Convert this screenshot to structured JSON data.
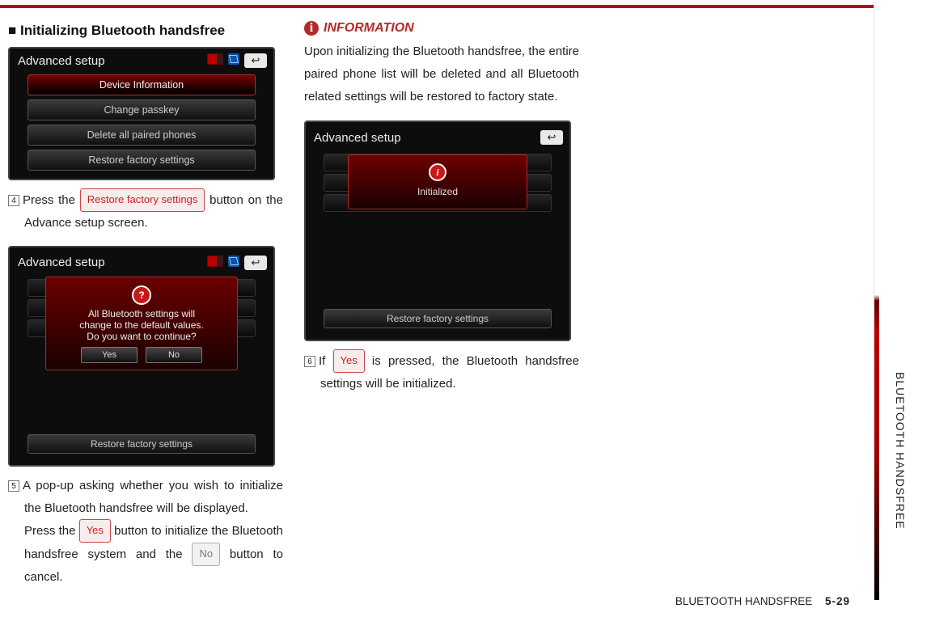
{
  "heading": "■ Initializing Bluetooth handsfree",
  "panel_title": "Advanced setup",
  "back_glyph": "↩",
  "menu": {
    "device_info": "Device Information",
    "change_passkey": "Change passkey",
    "delete_paired": "Delete all paired phones",
    "restore": "Restore factory settings"
  },
  "step4_num": "4",
  "step4_a": "Press the ",
  "step4_chip": "Restore factory settings",
  "step4_b": " button on the Advance setup screen.",
  "popup_q": "?",
  "popup_line1": "All Bluetooth settings will",
  "popup_line2": "change to the default values.",
  "popup_line3": "Do you want to continue?",
  "popup_yes": "Yes",
  "popup_no": "No",
  "popup_bottom": "Restore factory settings",
  "step5_num": "5",
  "step5_a": "A pop-up asking whether you wish to initialize the Bluetooth handsfree will be displayed.",
  "step5_b1": "Press the ",
  "step5_yes": "Yes",
  "step5_b2": "  button to initialize the Bluetooth handsfree system and the ",
  "step5_no": "No",
  "step5_b3": " button to cancel.",
  "info_glyph": "i",
  "info_title": "INFORMATION",
  "info_body": "Upon initializing the Bluetooth handsfree, the entire paired phone list will be deleted and all Bluetooth related settings will be restored to factory state.",
  "initialized": "Initialized",
  "step6_num": "6",
  "step6_a": "If ",
  "step6_yes": "Yes",
  "step6_b": " is pressed, the Bluetooth handsfree settings will be initialized.",
  "side_label": "BLUETOOTH HANDSFREE",
  "footer_label": "BLUETOOTH HANDSFREE",
  "page_number": "5-29"
}
